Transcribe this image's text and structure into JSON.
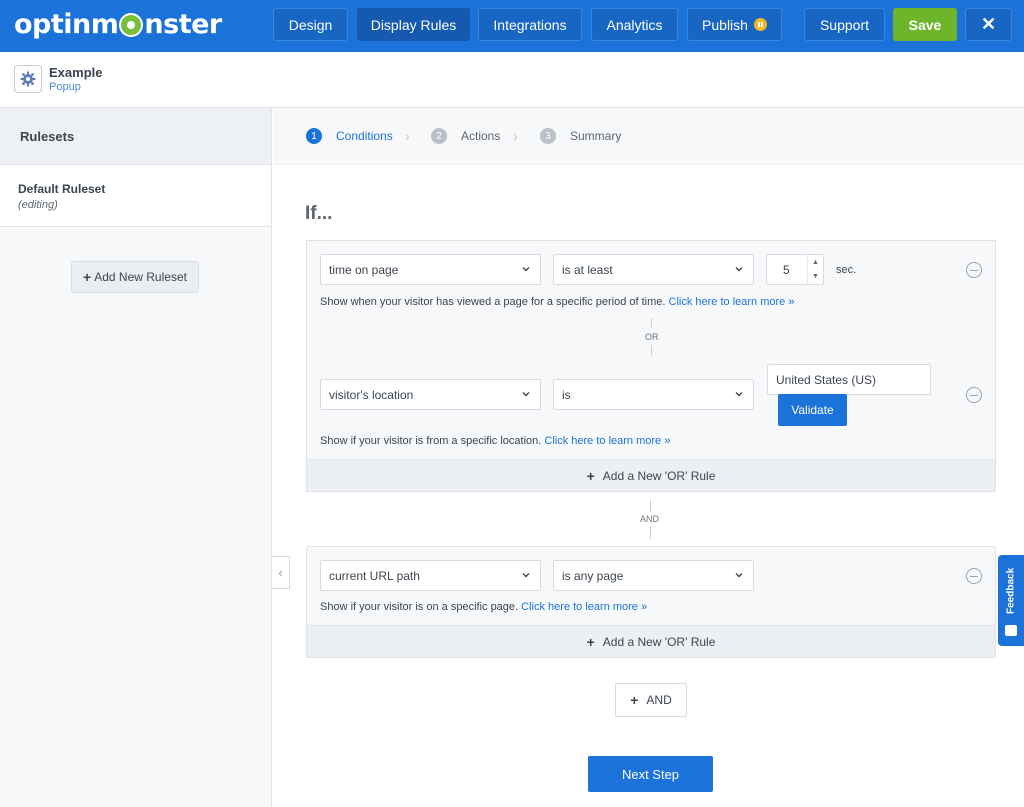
{
  "app": {
    "brand": "optinmonster",
    "brand_left": "optinm",
    "brand_right": "nster"
  },
  "nav": {
    "design": "Design",
    "display_rules": "Display Rules",
    "integrations": "Integrations",
    "analytics": "Analytics",
    "publish": "Publish",
    "support": "Support",
    "save": "Save",
    "close": "✕"
  },
  "campaign": {
    "title": "Example",
    "type": "Popup"
  },
  "sidebar": {
    "heading": "Rulesets",
    "ruleset_name": "Default Ruleset",
    "ruleset_status": "(editing)",
    "add_button": "Add New Ruleset"
  },
  "steps": [
    {
      "num": "1",
      "label": "Conditions",
      "active": true
    },
    {
      "num": "2",
      "label": "Actions",
      "active": false
    },
    {
      "num": "3",
      "label": "Summary",
      "active": false
    }
  ],
  "main": {
    "if_label": "If...",
    "or_label": "OR",
    "and_label": "AND",
    "add_or_label": "Add a New 'OR' Rule",
    "add_and_label": "AND",
    "next_step": "Next Step",
    "learn_more": "Click here to learn more »"
  },
  "rule1": {
    "condition": "time on page",
    "operator": "is at least",
    "value": "5",
    "unit": "sec.",
    "description": "Show when your visitor has viewed a page for a specific period of time."
  },
  "rule2": {
    "condition": "visitor's location",
    "operator": "is",
    "value": "United States (US)",
    "validate": "Validate",
    "description": "Show if your visitor is from a specific location."
  },
  "rule3": {
    "condition": "current URL path",
    "operator": "is any page",
    "description": "Show if your visitor is on a specific page."
  },
  "feedback": {
    "label": "Feedback"
  },
  "colors": {
    "primary": "#1b72d8",
    "save": "#6fb52c",
    "publish_badge": "#f3b81c"
  }
}
